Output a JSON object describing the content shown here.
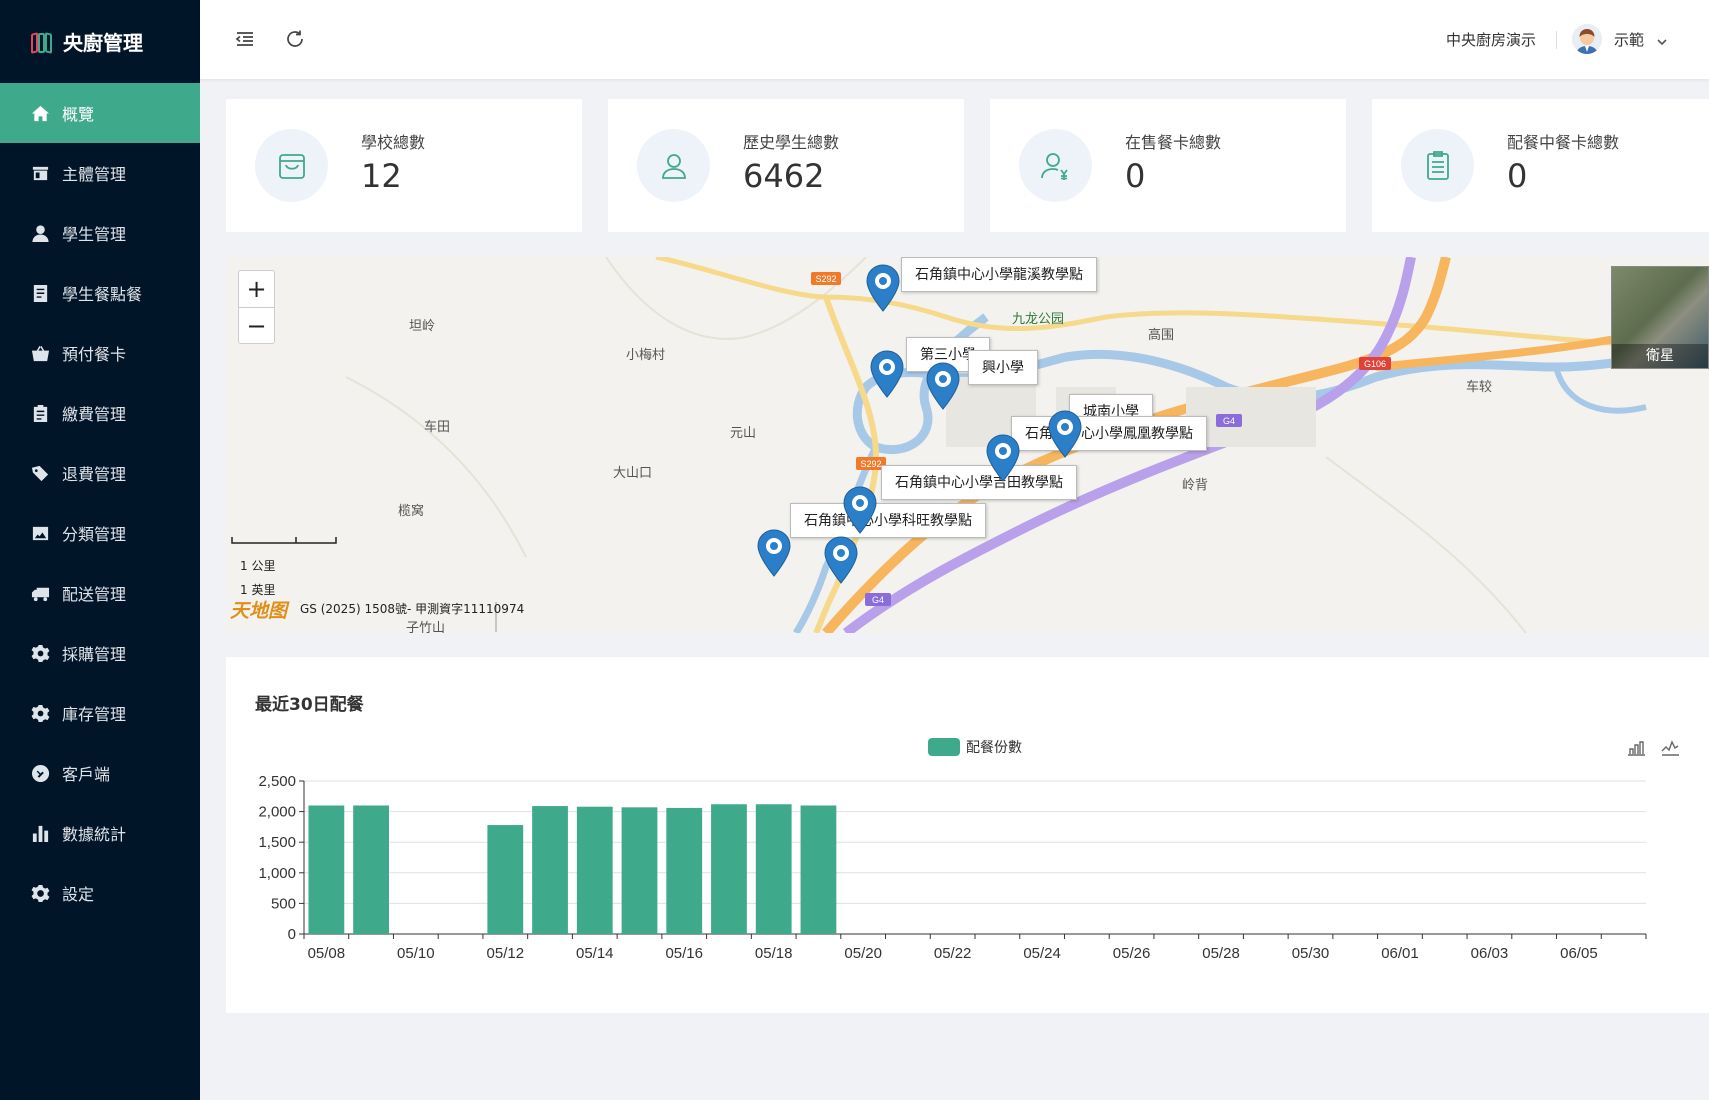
{
  "app": {
    "title": "央廚管理"
  },
  "sidebar": {
    "items": [
      {
        "label": "概覽",
        "icon": "home-icon",
        "active": true
      },
      {
        "label": "主體管理",
        "icon": "store-icon"
      },
      {
        "label": "學生管理",
        "icon": "user-icon"
      },
      {
        "label": "學生餐點餐",
        "icon": "document-icon"
      },
      {
        "label": "預付餐卡",
        "icon": "basket-icon"
      },
      {
        "label": "繳費管理",
        "icon": "clipboard-icon"
      },
      {
        "label": "退費管理",
        "icon": "tags-icon"
      },
      {
        "label": "分類管理",
        "icon": "picture-icon"
      },
      {
        "label": "配送管理",
        "icon": "truck-icon"
      },
      {
        "label": "採購管理",
        "icon": "gear-icon"
      },
      {
        "label": "庫存管理",
        "icon": "gear-icon"
      },
      {
        "label": "客戶端",
        "icon": "link-icon"
      },
      {
        "label": "數據統計",
        "icon": "bar-chart-icon"
      },
      {
        "label": "設定",
        "icon": "settings-icon"
      }
    ]
  },
  "header": {
    "collapse_icon": "menu-fold-icon",
    "refresh_icon": "refresh-icon",
    "org_name": "中央廚房演示",
    "user_name": "示範"
  },
  "stats": [
    {
      "label": "學校總數",
      "value": "12",
      "icon": "cart-icon"
    },
    {
      "label": "歷史學生總數",
      "value": "6462",
      "icon": "user-icon"
    },
    {
      "label": "在售餐卡總數",
      "value": "0",
      "icon": "user-yen-icon"
    },
    {
      "label": "配餐中餐卡總數",
      "value": "0",
      "icon": "list-icon"
    }
  ],
  "map": {
    "zoom_in": "+",
    "zoom_out": "−",
    "satellite_label": "衛星",
    "scale_metric": "1 公里",
    "scale_imperial": "1 英里",
    "copyright": "GS (2025) 1508號- 甲測資字11110974",
    "provider": "天地图",
    "places": [
      "坦岭",
      "小梅村",
      "车田",
      "元山",
      "大山口",
      "榄窝",
      "九龙公园",
      "高围",
      "车较",
      "岭背",
      "子竹山"
    ],
    "road_shields": [
      "S292",
      "S292",
      "G106",
      "G4",
      "G4"
    ],
    "markers": [
      {
        "label": "石角鎮中心小學龍溪教學點"
      },
      {
        "label": "第三小學"
      },
      {
        "label": "興小學"
      },
      {
        "label": "城南小學"
      },
      {
        "label": "石角鎮中心小學鳳凰教學點"
      },
      {
        "label": "石角鎮中心小學吉田教學點"
      },
      {
        "label": "石角鎮中心小學科旺教學點"
      }
    ]
  },
  "chart": {
    "title": "最近30日配餐",
    "tools": [
      "bar-chart-icon",
      "line-chart-icon"
    ]
  },
  "chart_data": {
    "type": "bar",
    "title": "最近30日配餐",
    "series": [
      {
        "name": "配餐份數",
        "color": "#3fa98c"
      }
    ],
    "categories": [
      "05/08",
      "05/09",
      "05/10",
      "05/11",
      "05/12",
      "05/13",
      "05/14",
      "05/15",
      "05/16",
      "05/17",
      "05/18",
      "05/19",
      "05/20",
      "05/21",
      "05/22",
      "05/23",
      "05/24",
      "05/25",
      "05/26",
      "05/27",
      "05/28",
      "05/29",
      "05/30",
      "05/31",
      "06/01",
      "06/02",
      "06/03",
      "06/04",
      "06/05",
      "06/06"
    ],
    "values": [
      2100,
      2100,
      0,
      0,
      1780,
      2090,
      2080,
      2070,
      2060,
      2120,
      2120,
      2100,
      0,
      0,
      0,
      0,
      0,
      0,
      0,
      0,
      0,
      0,
      0,
      0,
      0,
      0,
      0,
      0,
      0,
      0
    ],
    "x_tick_labels": [
      "05/08",
      "05/10",
      "05/12",
      "05/14",
      "05/16",
      "05/18",
      "05/20",
      "05/22",
      "05/24",
      "05/26",
      "05/28",
      "05/30",
      "06/01",
      "06/03",
      "06/05"
    ],
    "y_ticks": [
      "0",
      "500",
      "1,000",
      "1,500",
      "2,000",
      "2,500"
    ],
    "ylim": [
      0,
      2500
    ],
    "grid": true,
    "legend_position": "top-center"
  }
}
